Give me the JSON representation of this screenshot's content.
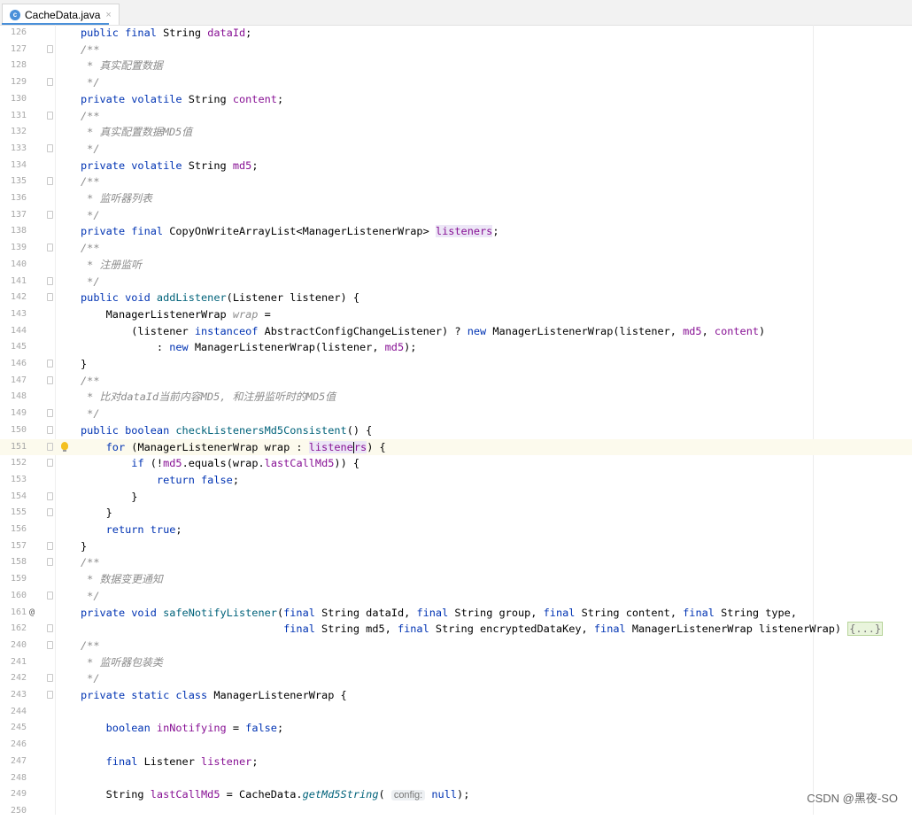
{
  "tab": {
    "icon": "c-class-icon",
    "icon_letter": "c",
    "title": "CacheData.java",
    "close": "×"
  },
  "lines": [
    {
      "n": "126",
      "fold": false,
      "tokens": [
        [
          "kw",
          "public final "
        ],
        [
          "",
          "String "
        ],
        [
          "fld",
          "dataId"
        ],
        [
          "",
          ";"
        ]
      ]
    },
    {
      "n": "127",
      "fold": true,
      "tokens": [
        [
          "cmt",
          "/**"
        ]
      ]
    },
    {
      "n": "128",
      "fold": false,
      "tokens": [
        [
          "cmt",
          " * 真实配置数据"
        ]
      ]
    },
    {
      "n": "129",
      "fold": true,
      "tokens": [
        [
          "cmt",
          " */"
        ]
      ]
    },
    {
      "n": "130",
      "fold": false,
      "tokens": [
        [
          "kw",
          "private volatile "
        ],
        [
          "",
          "String "
        ],
        [
          "fld",
          "content"
        ],
        [
          "",
          ";"
        ]
      ]
    },
    {
      "n": "131",
      "fold": true,
      "tokens": [
        [
          "cmt",
          "/**"
        ]
      ]
    },
    {
      "n": "132",
      "fold": false,
      "tokens": [
        [
          "cmt",
          " * 真实配置数据MD5值"
        ]
      ]
    },
    {
      "n": "133",
      "fold": true,
      "tokens": [
        [
          "cmt",
          " */"
        ]
      ]
    },
    {
      "n": "134",
      "fold": false,
      "tokens": [
        [
          "kw",
          "private volatile "
        ],
        [
          "",
          "String "
        ],
        [
          "fld",
          "md5"
        ],
        [
          "",
          ";"
        ]
      ]
    },
    {
      "n": "135",
      "fold": true,
      "tokens": [
        [
          "cmt",
          "/**"
        ]
      ]
    },
    {
      "n": "136",
      "fold": false,
      "tokens": [
        [
          "cmt",
          " * 监听器列表"
        ]
      ]
    },
    {
      "n": "137",
      "fold": true,
      "tokens": [
        [
          "cmt",
          " */"
        ]
      ]
    },
    {
      "n": "138",
      "fold": false,
      "tokens": [
        [
          "kw",
          "private final "
        ],
        [
          "",
          "CopyOnWriteArrayList<ManagerListenerWrap> "
        ],
        [
          "fld hl",
          "listeners"
        ],
        [
          "",
          ";"
        ]
      ]
    },
    {
      "n": "139",
      "fold": true,
      "tokens": [
        [
          "cmt",
          "/**"
        ]
      ]
    },
    {
      "n": "140",
      "fold": false,
      "tokens": [
        [
          "cmt",
          " * 注册监听"
        ]
      ]
    },
    {
      "n": "141",
      "fold": true,
      "tokens": [
        [
          "cmt",
          " */"
        ]
      ]
    },
    {
      "n": "142",
      "fold": true,
      "tokens": [
        [
          "kw",
          "public void "
        ],
        [
          "fn",
          "addListener"
        ],
        [
          "",
          "(Listener listener) {"
        ]
      ]
    },
    {
      "n": "143",
      "fold": false,
      "tokens": [
        [
          "",
          "    ManagerListenerWrap "
        ],
        [
          "cmt",
          "wrap"
        ],
        [
          "",
          " ="
        ]
      ]
    },
    {
      "n": "144",
      "fold": false,
      "tokens": [
        [
          "",
          "        (listener "
        ],
        [
          "kw",
          "instanceof "
        ],
        [
          "",
          "AbstractConfigChangeListener) ? "
        ],
        [
          "kw",
          "new "
        ],
        [
          "",
          "ManagerListenerWrap(listener, "
        ],
        [
          "fld",
          "md5"
        ],
        [
          "",
          ", "
        ],
        [
          "fld",
          "content"
        ],
        [
          "",
          ")"
        ]
      ]
    },
    {
      "n": "145",
      "fold": false,
      "tokens": [
        [
          "",
          "            : "
        ],
        [
          "kw",
          "new "
        ],
        [
          "",
          "ManagerListenerWrap(listener, "
        ],
        [
          "fld",
          "md5"
        ],
        [
          "",
          ");"
        ]
      ]
    },
    {
      "n": "146",
      "fold": true,
      "tokens": [
        [
          "",
          "}"
        ]
      ]
    },
    {
      "n": "147",
      "fold": true,
      "tokens": [
        [
          "cmt",
          "/**"
        ]
      ]
    },
    {
      "n": "148",
      "fold": false,
      "tokens": [
        [
          "cmt",
          " * 比对dataId当前内容MD5, 和注册监听时的MD5值"
        ]
      ]
    },
    {
      "n": "149",
      "fold": true,
      "tokens": [
        [
          "cmt",
          " */"
        ]
      ]
    },
    {
      "n": "150",
      "fold": true,
      "tokens": [
        [
          "kw",
          "public boolean "
        ],
        [
          "fn",
          "checkListenersMd5Consistent"
        ],
        [
          "",
          "() {"
        ]
      ]
    },
    {
      "n": "151",
      "fold": true,
      "cur": true,
      "bulb": true,
      "tokens": [
        [
          "",
          "    "
        ],
        [
          "kw",
          "for "
        ],
        [
          "",
          "(ManagerListenerWrap wrap : "
        ],
        [
          "fld hl",
          "listene"
        ],
        [
          "caret",
          ""
        ],
        [
          "fld hl",
          "rs"
        ],
        [
          "",
          ") {"
        ]
      ]
    },
    {
      "n": "152",
      "fold": true,
      "tokens": [
        [
          "",
          "        "
        ],
        [
          "kw",
          "if "
        ],
        [
          "",
          "(!"
        ],
        [
          "fld",
          "md5"
        ],
        [
          "",
          ".equals(wrap."
        ],
        [
          "fld",
          "lastCallMd5"
        ],
        [
          "",
          ")) {"
        ]
      ]
    },
    {
      "n": "153",
      "fold": false,
      "tokens": [
        [
          "",
          "            "
        ],
        [
          "kw",
          "return false"
        ],
        [
          "",
          ";"
        ]
      ]
    },
    {
      "n": "154",
      "fold": true,
      "tokens": [
        [
          "",
          "        }"
        ]
      ]
    },
    {
      "n": "155",
      "fold": true,
      "tokens": [
        [
          "",
          "    }"
        ]
      ]
    },
    {
      "n": "156",
      "fold": false,
      "tokens": [
        [
          "",
          "    "
        ],
        [
          "kw",
          "return true"
        ],
        [
          "",
          ";"
        ]
      ]
    },
    {
      "n": "157",
      "fold": true,
      "tokens": [
        [
          "",
          "}"
        ]
      ]
    },
    {
      "n": "158",
      "fold": true,
      "tokens": [
        [
          "cmt",
          "/**"
        ]
      ]
    },
    {
      "n": "159",
      "fold": false,
      "tokens": [
        [
          "cmt",
          " * 数据变更通知"
        ]
      ]
    },
    {
      "n": "160",
      "fold": true,
      "tokens": [
        [
          "cmt",
          " */"
        ]
      ]
    },
    {
      "n": "161",
      "fold": false,
      "at": true,
      "tokens": [
        [
          "kw",
          "private void "
        ],
        [
          "fn",
          "safeNotifyListener"
        ],
        [
          "",
          "("
        ],
        [
          "kw",
          "final "
        ],
        [
          "",
          "String dataId, "
        ],
        [
          "kw",
          "final "
        ],
        [
          "",
          "String group, "
        ],
        [
          "kw",
          "final "
        ],
        [
          "",
          "String content, "
        ],
        [
          "kw",
          "final "
        ],
        [
          "",
          "String type,"
        ]
      ]
    },
    {
      "n": "162",
      "fold": true,
      "tokens": [
        [
          "",
          "                                "
        ],
        [
          "kw",
          "final "
        ],
        [
          "",
          "String md5, "
        ],
        [
          "kw",
          "final "
        ],
        [
          "",
          "String encryptedDataKey, "
        ],
        [
          "kw",
          "final "
        ],
        [
          "",
          "ManagerListenerWrap listenerWrap) "
        ],
        [
          "folded",
          "{...}"
        ]
      ]
    },
    {
      "n": "240",
      "fold": true,
      "tokens": [
        [
          "cmt",
          "/**"
        ]
      ]
    },
    {
      "n": "241",
      "fold": false,
      "tokens": [
        [
          "cmt",
          " * 监听器包装类"
        ]
      ]
    },
    {
      "n": "242",
      "fold": true,
      "tokens": [
        [
          "cmt",
          " */"
        ]
      ]
    },
    {
      "n": "243",
      "fold": true,
      "tokens": [
        [
          "kw",
          "private static class "
        ],
        [
          "",
          "ManagerListenerWrap {"
        ]
      ]
    },
    {
      "n": "244",
      "fold": false,
      "tokens": []
    },
    {
      "n": "245",
      "fold": false,
      "tokens": [
        [
          "",
          "    "
        ],
        [
          "kw",
          "boolean "
        ],
        [
          "fld",
          "inNotifying"
        ],
        [
          "",
          " = "
        ],
        [
          "kw",
          "false"
        ],
        [
          "",
          ";"
        ]
      ]
    },
    {
      "n": "246",
      "fold": false,
      "tokens": []
    },
    {
      "n": "247",
      "fold": false,
      "tokens": [
        [
          "",
          "    "
        ],
        [
          "kw",
          "final "
        ],
        [
          "",
          "Listener "
        ],
        [
          "fld",
          "listener"
        ],
        [
          "",
          ";"
        ]
      ]
    },
    {
      "n": "248",
      "fold": false,
      "tokens": []
    },
    {
      "n": "249",
      "fold": false,
      "tokens": [
        [
          "",
          "    String "
        ],
        [
          "fld",
          "lastCallMd5"
        ],
        [
          "",
          " = CacheData."
        ],
        [
          "fn-i",
          "getMd5String"
        ],
        [
          "",
          "( "
        ],
        [
          "hint",
          "config:"
        ],
        [
          "",
          ""
        ],
        [
          "kw",
          " null"
        ],
        [
          "",
          ");"
        ]
      ]
    },
    {
      "n": "250",
      "fold": false,
      "tokens": []
    }
  ],
  "watermark": "CSDN @黑夜-SO"
}
